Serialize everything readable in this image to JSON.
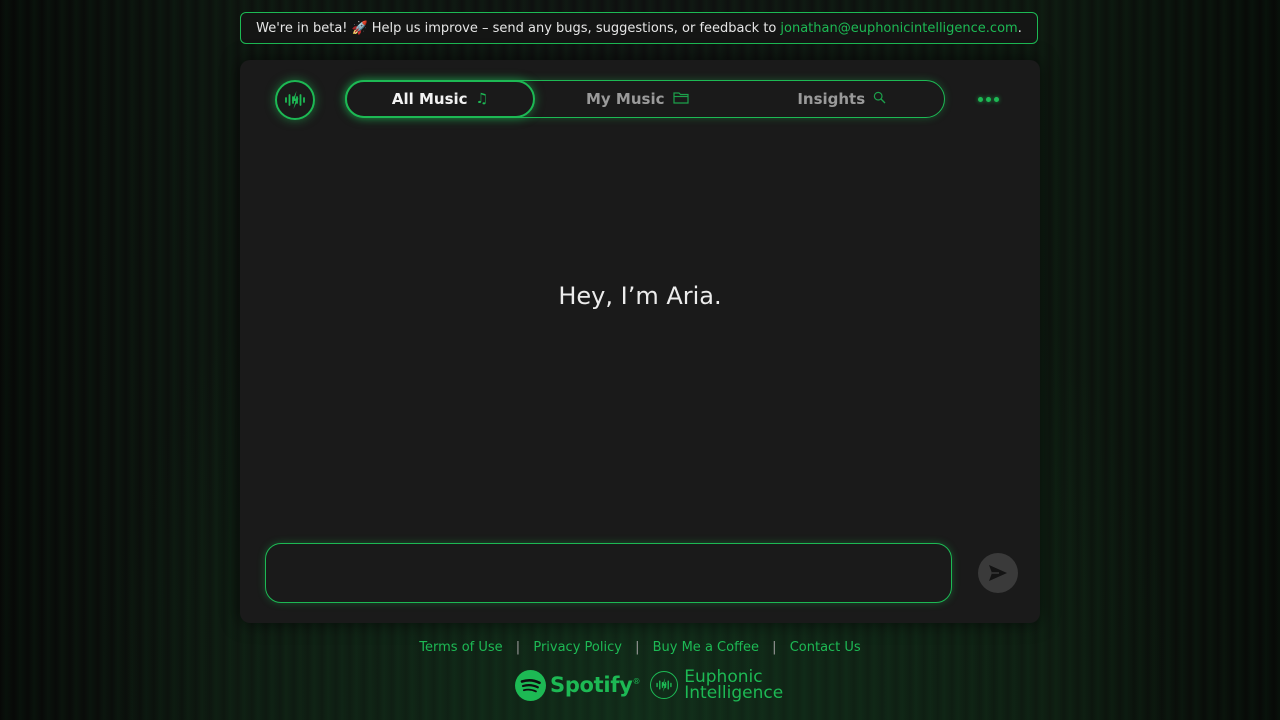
{
  "banner": {
    "text": "We're in beta!",
    "rocket": "🚀",
    "message": "Help us improve – send any bugs, suggestions, or feedback to",
    "email": "jonathan@euphonicintelligence.com",
    "period": "."
  },
  "tabs": [
    {
      "label": "All Music",
      "icon": "music-note-icon",
      "active": true
    },
    {
      "label": "My Music",
      "icon": "folder-icon",
      "active": false
    },
    {
      "label": "Insights",
      "icon": "search-icon",
      "active": false
    }
  ],
  "main": {
    "greeting": "Hey, I’m Aria."
  },
  "chat": {
    "placeholder": "",
    "value": ""
  },
  "footer": {
    "links": [
      "Terms of Use",
      "Privacy Policy",
      "Buy Me a Coffee",
      "Contact Us"
    ],
    "separator": "|",
    "spotify": "Spotify",
    "euphonic_line1": "Euphonic",
    "euphonic_line2": "Intelligence"
  },
  "colors": {
    "accent": "#1db954",
    "background": "#0e0f0f",
    "card": "#1a1a1a"
  }
}
